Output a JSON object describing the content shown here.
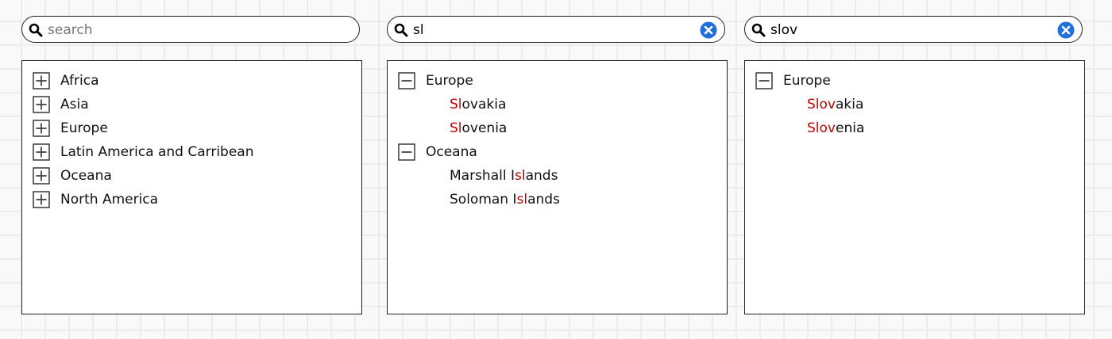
{
  "colors": {
    "highlight": "#c00000",
    "clear_button": "#1f6fe0",
    "border": "#222222"
  },
  "panels": [
    {
      "search": {
        "value": "",
        "placeholder": "search",
        "clear_visible": false
      },
      "tree": [
        {
          "type": "node",
          "expanded": false,
          "label": "Africa"
        },
        {
          "type": "node",
          "expanded": false,
          "label": "Asia"
        },
        {
          "type": "node",
          "expanded": false,
          "label": "Europe"
        },
        {
          "type": "node",
          "expanded": false,
          "label": "Latin America and Carribean"
        },
        {
          "type": "node",
          "expanded": false,
          "label": "Oceana"
        },
        {
          "type": "node",
          "expanded": false,
          "label": "North America"
        }
      ]
    },
    {
      "search": {
        "value": "sl",
        "placeholder": "search",
        "clear_visible": true
      },
      "tree": [
        {
          "type": "node",
          "expanded": true,
          "label": "Europe"
        },
        {
          "type": "leaf",
          "parts": [
            {
              "text": "Sl",
              "hl": true
            },
            {
              "text": "ovakia",
              "hl": false
            }
          ]
        },
        {
          "type": "leaf",
          "parts": [
            {
              "text": "Sl",
              "hl": true
            },
            {
              "text": "ovenia",
              "hl": false
            }
          ]
        },
        {
          "type": "node",
          "expanded": true,
          "label": "Oceana"
        },
        {
          "type": "leaf",
          "parts": [
            {
              "text": "Marshall I",
              "hl": false
            },
            {
              "text": "sl",
              "hl": true
            },
            {
              "text": "ands",
              "hl": false
            }
          ]
        },
        {
          "type": "leaf",
          "parts": [
            {
              "text": "Soloman I",
              "hl": false
            },
            {
              "text": "sl",
              "hl": true
            },
            {
              "text": "ands",
              "hl": false
            }
          ]
        }
      ]
    },
    {
      "search": {
        "value": "slov",
        "placeholder": "search",
        "clear_visible": true
      },
      "tree": [
        {
          "type": "node",
          "expanded": true,
          "label": "Europe"
        },
        {
          "type": "leaf",
          "parts": [
            {
              "text": "Slov",
              "hl": true
            },
            {
              "text": "akia",
              "hl": false
            }
          ]
        },
        {
          "type": "leaf",
          "parts": [
            {
              "text": "Slov",
              "hl": true
            },
            {
              "text": "enia",
              "hl": false
            }
          ]
        }
      ]
    }
  ]
}
